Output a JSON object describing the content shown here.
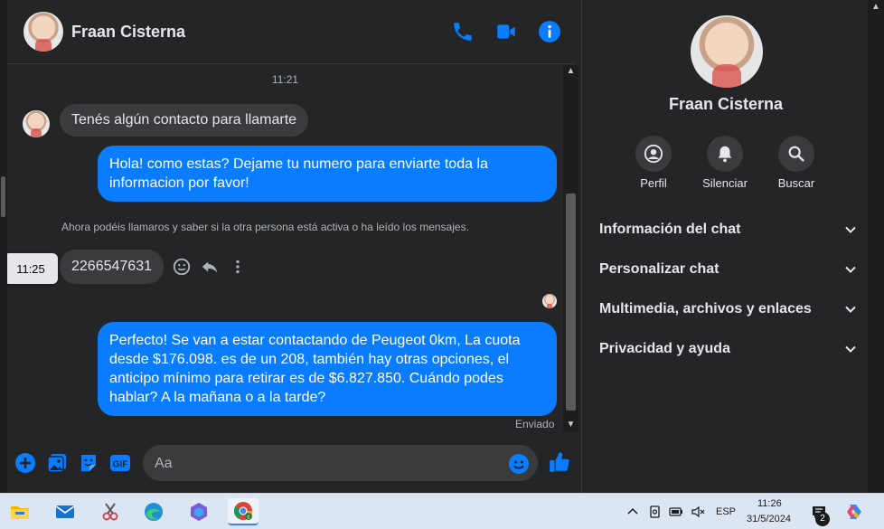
{
  "contact": {
    "name": "Fraan Cisterna"
  },
  "chat": {
    "time_first": "11:21",
    "incoming_1": "Tenés algún contacto para llamarte",
    "outgoing_1": "Hola! como estas? Dejame tu numero para enviarte toda la informacion por favor!",
    "notice": "Ahora podéis llamaros y saber si la otra persona está activa o ha leído los mensajes.",
    "tooltip_time": "11:25",
    "incoming_2": "2266547631",
    "outgoing_2": "Perfecto!  Se van a estar contactando de Peugeot 0km, La cuota desde $176.098. es de un 208, también hay otras opciones, el anticipo mínimo para retirar es de $6.827.850. Cuándo podes hablar? A la mañana o a la tarde?",
    "status": "Enviado"
  },
  "composer": {
    "placeholder": "Aa"
  },
  "panel": {
    "actions": [
      "Perfil",
      "Silenciar",
      "Buscar"
    ],
    "sections": [
      "Información del chat",
      "Personalizar chat",
      "Multimedia, archivos y enlaces",
      "Privacidad y ayuda"
    ]
  },
  "taskbar": {
    "language": "ESP",
    "time": "11:26",
    "date": "31/5/2024",
    "notification_count": "2"
  },
  "colors": {
    "accent": "#0a7cff",
    "background": "#242526",
    "bubble_in": "#3a3b3c"
  }
}
